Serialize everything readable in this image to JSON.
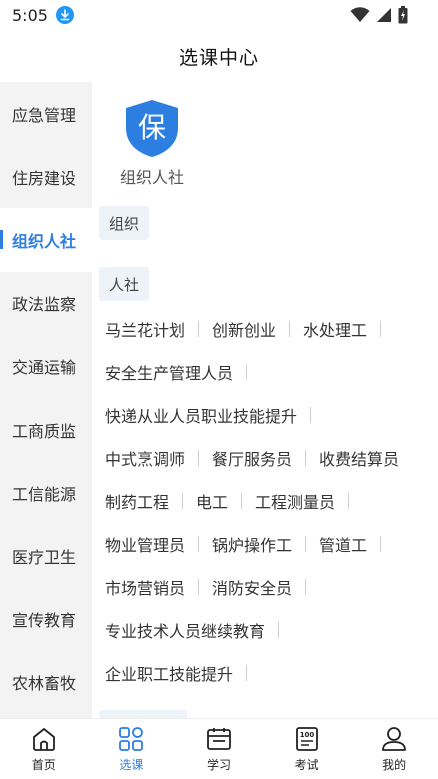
{
  "status": {
    "time": "5:05"
  },
  "header": {
    "title": "选课中心"
  },
  "sidebar": {
    "items": [
      {
        "label": "应急管理"
      },
      {
        "label": "住房建设"
      },
      {
        "label": "组织人社"
      },
      {
        "label": "政法监察"
      },
      {
        "label": "交通运输"
      },
      {
        "label": "工商质监"
      },
      {
        "label": "工信能源"
      },
      {
        "label": "医疗卫生"
      },
      {
        "label": "宣传教育"
      },
      {
        "label": "农林畜牧"
      }
    ],
    "active_label": "组织人社"
  },
  "org": {
    "badge_char": "保",
    "name": "组织人社",
    "accent": "#2c7ee0"
  },
  "sections": [
    {
      "label": "组织"
    },
    {
      "label": "人社"
    }
  ],
  "courses": [
    [
      "马兰花计划",
      "创新创业",
      "水处理工"
    ],
    [
      "安全生产管理人员"
    ],
    [
      "快递从业人员职业技能提升"
    ],
    [
      "中式烹调师",
      "餐厅服务员",
      "收费结算员"
    ],
    [
      "制药工程",
      "电工",
      "工程测量员"
    ],
    [
      "物业管理员",
      "锅炉操作工",
      "管道工"
    ],
    [
      "市场营销员",
      "消防安全员"
    ],
    [
      "专业技术人员继续教育"
    ],
    [
      "企业职工技能提升"
    ]
  ],
  "nav": [
    {
      "label": "首页",
      "icon": "home-icon"
    },
    {
      "label": "选课",
      "icon": "grid-icon"
    },
    {
      "label": "学习",
      "icon": "calendar-icon"
    },
    {
      "label": "考试",
      "icon": "exam-icon"
    },
    {
      "label": "我的",
      "icon": "user-icon"
    }
  ],
  "nav_active_label": "选课"
}
